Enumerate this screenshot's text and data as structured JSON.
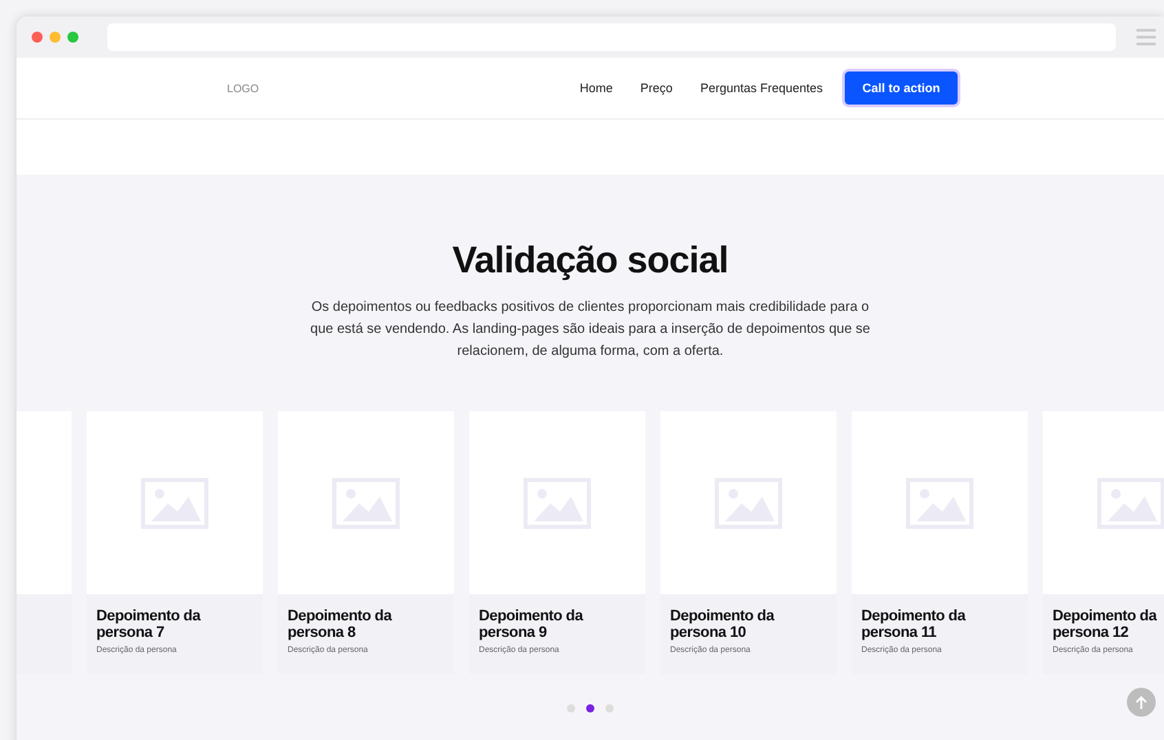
{
  "nav": {
    "logo": "LOGO",
    "links": [
      "Home",
      "Preço",
      "Perguntas Frequentes"
    ],
    "cta": "Call to action"
  },
  "section": {
    "title": "Validação social",
    "text": "Os depoimentos ou feedbacks positivos de clientes proporcionam mais credibilidade para o que está se vendendo. As landing-pages são ideais para a inserção de depoimentos que se relacionem, de alguma forma, com a oferta."
  },
  "cards": [
    {
      "title": "Depoimento da persona 7",
      "description": "Descrição da persona"
    },
    {
      "title": "Depoimento da persona 8",
      "description": "Descrição da persona"
    },
    {
      "title": "Depoimento da persona 9",
      "description": "Descrição da persona"
    },
    {
      "title": "Depoimento da persona 10",
      "description": "Descrição da persona"
    },
    {
      "title": "Depoimento da persona 11",
      "description": "Descrição da persona"
    },
    {
      "title": "Depoimento da persona 12",
      "description": "Descrição da persona"
    }
  ],
  "pagination": [
    {
      "selected": false
    },
    {
      "selected": true
    },
    {
      "selected": false
    }
  ]
}
